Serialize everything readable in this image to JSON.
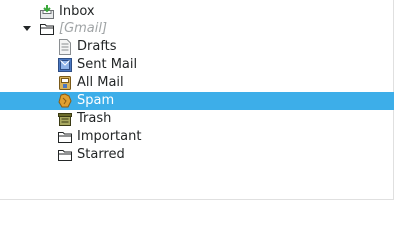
{
  "folders": {
    "inbox": {
      "label": "Inbox",
      "icon": "inbox-icon"
    },
    "gmail": {
      "label": "[Gmail]",
      "icon": "folder-icon",
      "expanded": true
    },
    "drafts": {
      "label": "Drafts",
      "icon": "drafts-icon"
    },
    "sent_mail": {
      "label": "Sent Mail",
      "icon": "sent-mail-icon"
    },
    "all_mail": {
      "label": "All Mail",
      "icon": "all-mail-icon"
    },
    "spam": {
      "label": "Spam",
      "icon": "spam-icon",
      "selected": true
    },
    "trash": {
      "label": "Trash",
      "icon": "trash-icon"
    },
    "important": {
      "label": "Important",
      "icon": "folder-icon"
    },
    "starred": {
      "label": "Starred",
      "icon": "folder-icon"
    }
  },
  "colors": {
    "selection": "#3daee9",
    "text": "#232627",
    "disabled_text": "#a0a4a6"
  }
}
